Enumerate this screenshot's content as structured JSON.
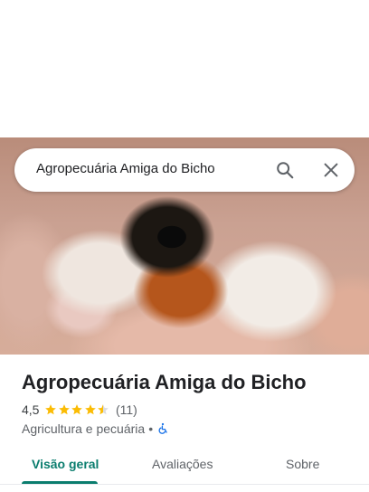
{
  "search": {
    "query": "Agropecuária Amiga do Bicho"
  },
  "place": {
    "name": "Agropecuária Amiga do Bicho",
    "rating": "4,5",
    "stars": 4.5,
    "review_count": "(11)",
    "category": "Agricultura e pecuária",
    "separator": "•"
  },
  "tabs": [
    {
      "label": "Visão geral",
      "active": true
    },
    {
      "label": "Avaliações",
      "active": false
    },
    {
      "label": "Sobre",
      "active": false
    }
  ],
  "colors": {
    "accent": "#0a7d6e",
    "star": "#fbbc04",
    "accessibility": "#1a73e8"
  },
  "icons": {
    "search": "search-icon",
    "close": "close-icon",
    "accessibility": "wheelchair-icon"
  }
}
